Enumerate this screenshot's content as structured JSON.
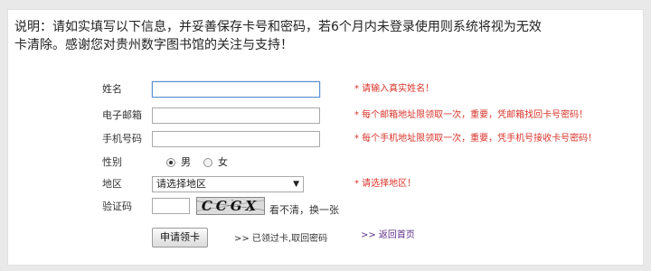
{
  "intro": {
    "line1": "说明：请如实填写以下信息，并妥善保存卡号和密码，若6个月内未登录使用则系统将视为无效",
    "line2": "卡清除。感谢您对贵州数字图书馆的关注与支持！"
  },
  "form": {
    "name": {
      "label": "姓名",
      "value": "",
      "hint": "* 请输入真实姓名！"
    },
    "email": {
      "label": "电子邮箱",
      "value": "",
      "hint": "* 每个邮箱地址限领取一次，重要，凭邮箱找回卡号密码！"
    },
    "phone": {
      "label": "手机号码",
      "value": "",
      "hint": "* 每个手机地址限领取一次，重要，凭手机号接收卡号密码！"
    },
    "gender": {
      "label": "性别",
      "male": "男",
      "female": "女",
      "selected": "male"
    },
    "region": {
      "label": "地区",
      "selected": "请选择地区",
      "hint": "* 请选择地区！"
    },
    "captcha": {
      "label": "验证码",
      "image_text": "CCGX",
      "refresh": "看不清，换一张"
    },
    "submit_label": "申请领卡",
    "retrieve_link": ">> 已领过卡,取回密码",
    "home_link": ">> 返回首页"
  },
  "colors": {
    "hint_red": "#d9342b",
    "home_link_purple": "#5a2d8a",
    "focus_blue": "#5b8fd1"
  }
}
